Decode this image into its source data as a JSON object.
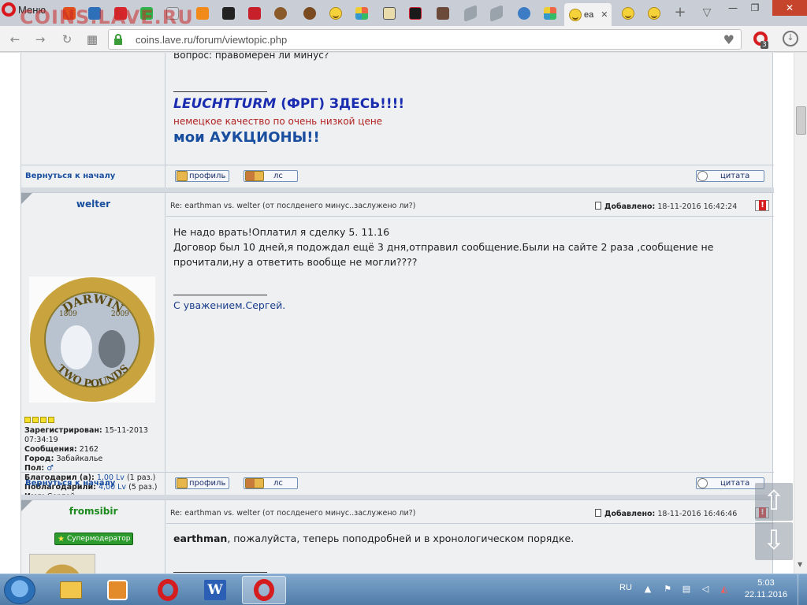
{
  "browser": {
    "menu_label": "Меню",
    "watermark": "COINS.LAVE.RU",
    "active_tab_title": "ea",
    "close_tab": "✕",
    "url": "coins.lave.ru/forum/viewtopic.php",
    "extension_badge": "3"
  },
  "top_post": {
    "question_fragment": "Вопрос: правомерен ли минус?",
    "sig_leuchtturm_word": "LEUCHTTURM",
    "sig_leuchtturm_rest": " (ФРГ) ЗДЕСЬ!!!!",
    "sig_quality": "немецкое качество по очень низкой цене",
    "sig_auctions": "мои АУКЦИОНЫ!!",
    "back_to_top": "Вернуться к началу",
    "profile_btn": "профиль",
    "pm_btn": "лс",
    "quote_btn": "цитата"
  },
  "post1": {
    "author": "welter",
    "subject": "Re: earthman vs. welter (от послденего минус..заслужено ли?)",
    "added_label": "Добавлено:",
    "added_date": "18-11-2016 16:42:24",
    "line1": "Не надо врать!Оплатил я сделку 5. 11.16",
    "line2": "Договор был 10 дней,я подождал ещё 3 дня,отправил сообщение.Были на сайте 2 раза ,сообщение не",
    "line3": "прочитали,ну а ответить вообще не могли????",
    "signature": "С уважением.Сергей.",
    "coin_top": "DARWIN",
    "coin_year_left": "1809",
    "coin_year_right": "2009",
    "coin_bottom": "TWO POUNDS",
    "profile": {
      "registered_label": "Зарегистрирован:",
      "registered_value": "15-11-2013 07:34:19",
      "messages_label": "Сообщения:",
      "messages_value": "2162",
      "city_label": "Город:",
      "city_value": "Забайкалье",
      "gender_label": "Пол:",
      "gender_value": "♂",
      "thanked_label": "Благодарил (а):",
      "thanked_value": "1,00 Lv",
      "thanked_count": "(1 раз.)",
      "got_thanks_label": "Поблагодарили:",
      "got_thanks_value": "4,00 Lv",
      "got_thanks_count": "(5 раз.)",
      "name_label": "Имя:",
      "name_value": "Сергей"
    },
    "back_to_top": "Вернуться к началу",
    "profile_btn": "профиль",
    "pm_btn": "лс",
    "quote_btn": "цитата"
  },
  "post2": {
    "author": "fromsibir",
    "subject": "Re: earthman vs. welter (от послденего минус..заслужено ли?)",
    "added_label": "Добавлено:",
    "added_date": "18-11-2016 16:46:46",
    "badge": "Супермодератор",
    "mention": "earthman",
    "text_rest": ", пожалуйста, теперь поподробней и в хронологическом порядке."
  },
  "float_buttons": {
    "up": "⇧",
    "down": "⇩"
  },
  "taskbar": {
    "word_label": "W",
    "lang": "RU",
    "time": "5:03",
    "date": "22.11.2016"
  },
  "colors": {
    "accent_blue": "#1a4fa0",
    "moderator_green": "#1d8a1d",
    "opera_red": "#d51c1f"
  }
}
